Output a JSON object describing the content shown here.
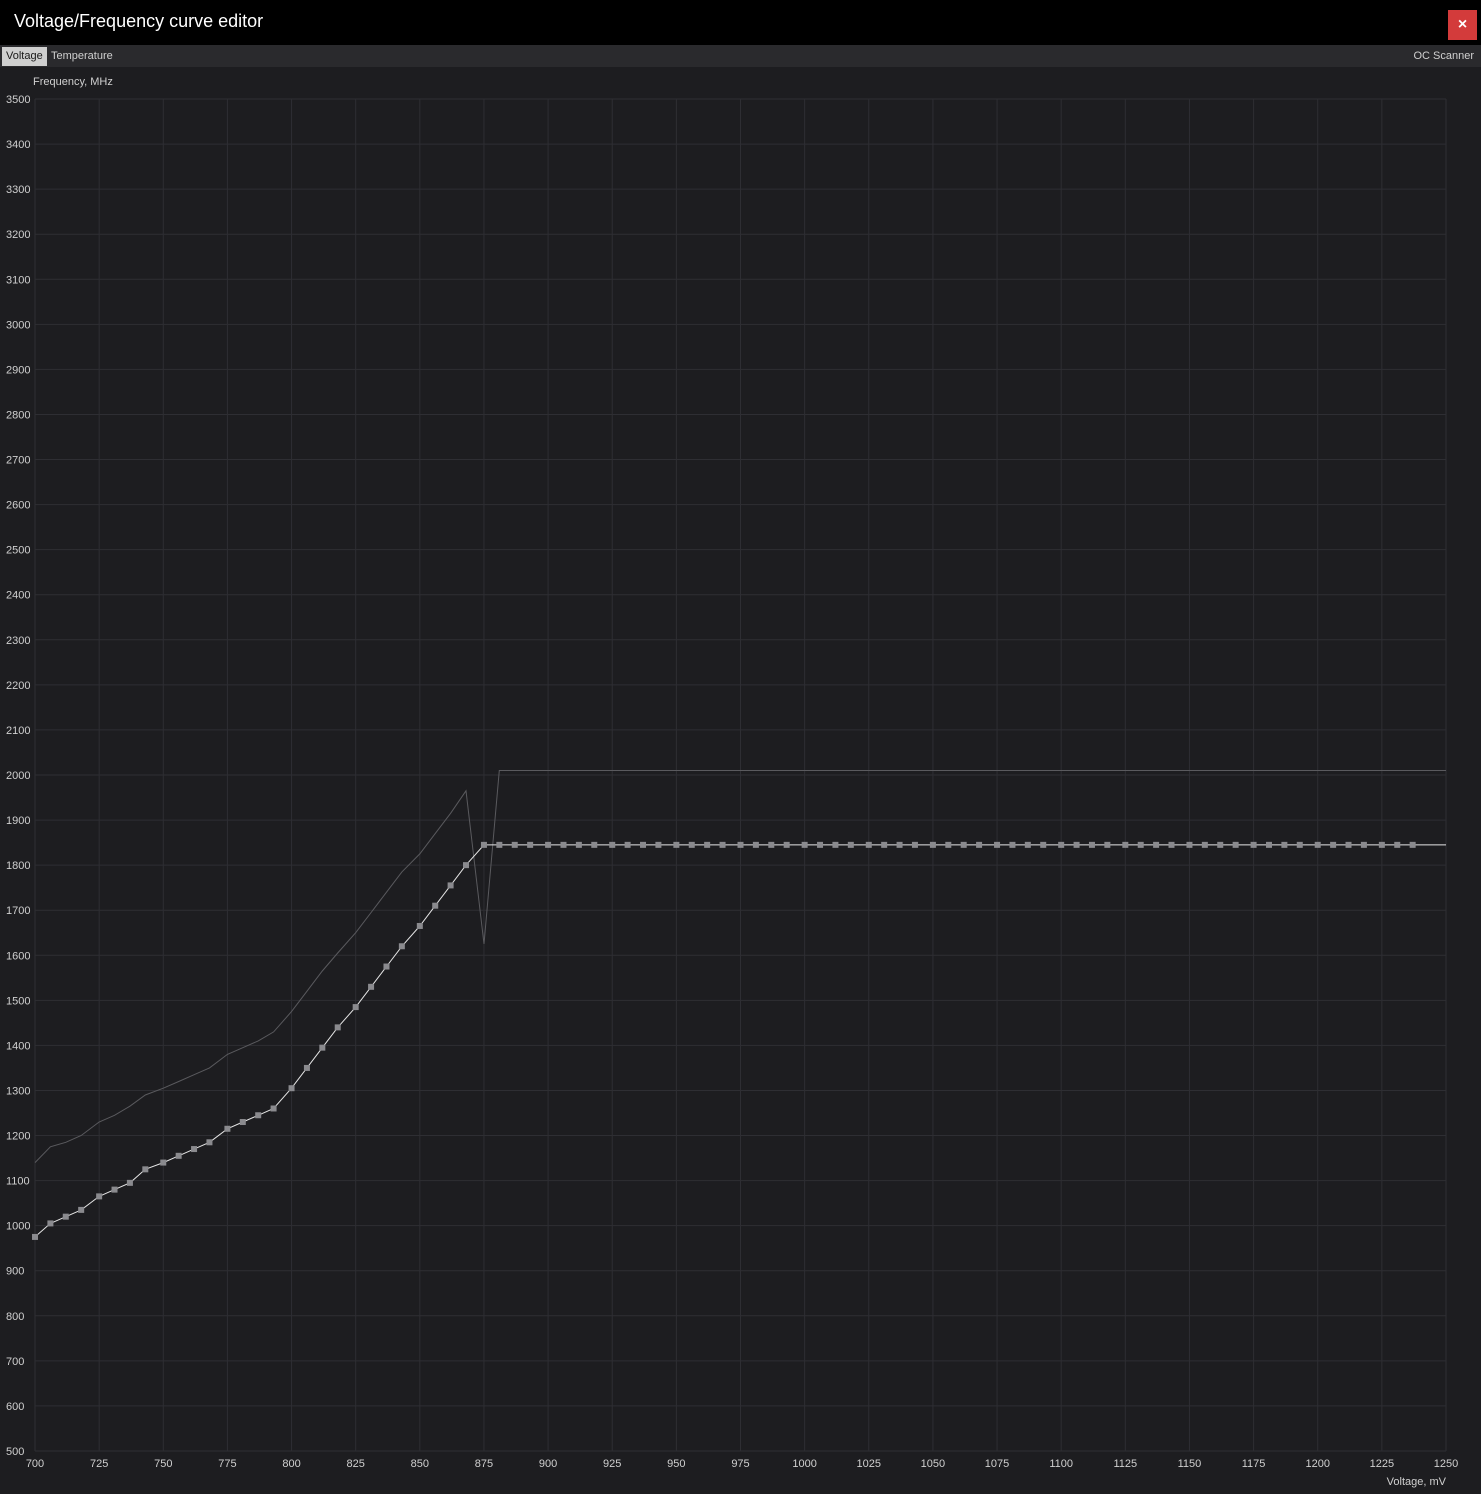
{
  "window": {
    "title": "Voltage/Frequency curve editor",
    "close_label": "×",
    "close_color": "#d33b3b"
  },
  "tabs": [
    {
      "label": "Voltage",
      "selected": true
    },
    {
      "label": "Temperature",
      "selected": false
    }
  ],
  "oc_scanner_label": "OC Scanner",
  "chart_data": {
    "type": "line",
    "xlabel": "Voltage, mV",
    "ylabel": "Frequency, MHz",
    "xlim": [
      700,
      1250
    ],
    "ylim": [
      500,
      3500
    ],
    "x_ticks": [
      700,
      725,
      750,
      775,
      800,
      825,
      850,
      875,
      900,
      925,
      950,
      975,
      1000,
      1025,
      1050,
      1075,
      1100,
      1125,
      1150,
      1175,
      1200,
      1225,
      1250
    ],
    "y_ticks": [
      500,
      600,
      700,
      800,
      900,
      1000,
      1100,
      1200,
      1300,
      1400,
      1500,
      1600,
      1700,
      1800,
      1900,
      2000,
      2100,
      2200,
      2300,
      2400,
      2500,
      2600,
      2700,
      2800,
      2900,
      3000,
      3100,
      3200,
      3300,
      3400,
      3500
    ],
    "grid": true,
    "series": [
      {
        "style": "upper-curve",
        "color": "#5a5a5e",
        "points": [
          [
            700,
            1140
          ],
          [
            706,
            1175
          ],
          [
            712,
            1185
          ],
          [
            718,
            1200
          ],
          [
            725,
            1230
          ],
          [
            731,
            1245
          ],
          [
            737,
            1265
          ],
          [
            743,
            1290
          ],
          [
            750,
            1305
          ],
          [
            756,
            1320
          ],
          [
            762,
            1335
          ],
          [
            768,
            1350
          ],
          [
            775,
            1380
          ],
          [
            781,
            1395
          ],
          [
            787,
            1410
          ],
          [
            793,
            1430
          ],
          [
            800,
            1475
          ],
          [
            806,
            1520
          ],
          [
            812,
            1565
          ],
          [
            818,
            1605
          ],
          [
            825,
            1650
          ],
          [
            831,
            1695
          ],
          [
            837,
            1740
          ],
          [
            843,
            1785
          ],
          [
            850,
            1825
          ],
          [
            856,
            1870
          ],
          [
            862,
            1915
          ],
          [
            868,
            1965
          ],
          [
            875,
            1625
          ],
          [
            881,
            2010
          ],
          [
            1250,
            2010
          ]
        ]
      },
      {
        "style": "curve-with-points",
        "color": "#e6e6e6",
        "point_color": "#8a8a8e",
        "points": [
          [
            700,
            975
          ],
          [
            706,
            1005
          ],
          [
            712,
            1020
          ],
          [
            718,
            1035
          ],
          [
            725,
            1065
          ],
          [
            731,
            1080
          ],
          [
            737,
            1095
          ],
          [
            743,
            1125
          ],
          [
            750,
            1140
          ],
          [
            756,
            1155
          ],
          [
            762,
            1170
          ],
          [
            768,
            1185
          ],
          [
            775,
            1215
          ],
          [
            781,
            1230
          ],
          [
            787,
            1245
          ],
          [
            793,
            1260
          ],
          [
            800,
            1305
          ],
          [
            806,
            1350
          ],
          [
            812,
            1395
          ],
          [
            818,
            1440
          ],
          [
            825,
            1485
          ],
          [
            831,
            1530
          ],
          [
            837,
            1575
          ],
          [
            843,
            1620
          ],
          [
            850,
            1665
          ],
          [
            856,
            1710
          ],
          [
            862,
            1755
          ],
          [
            868,
            1800
          ],
          [
            875,
            1845
          ],
          [
            881,
            1845
          ],
          [
            887,
            1845
          ],
          [
            893,
            1845
          ],
          [
            900,
            1845
          ],
          [
            906,
            1845
          ],
          [
            912,
            1845
          ],
          [
            918,
            1845
          ],
          [
            925,
            1845
          ],
          [
            931,
            1845
          ],
          [
            937,
            1845
          ],
          [
            943,
            1845
          ],
          [
            950,
            1845
          ],
          [
            956,
            1845
          ],
          [
            962,
            1845
          ],
          [
            968,
            1845
          ],
          [
            975,
            1845
          ],
          [
            981,
            1845
          ],
          [
            987,
            1845
          ],
          [
            993,
            1845
          ],
          [
            1000,
            1845
          ],
          [
            1006,
            1845
          ],
          [
            1012,
            1845
          ],
          [
            1018,
            1845
          ],
          [
            1025,
            1845
          ],
          [
            1031,
            1845
          ],
          [
            1037,
            1845
          ],
          [
            1043,
            1845
          ],
          [
            1050,
            1845
          ],
          [
            1056,
            1845
          ],
          [
            1062,
            1845
          ],
          [
            1068,
            1845
          ],
          [
            1075,
            1845
          ],
          [
            1081,
            1845
          ],
          [
            1087,
            1845
          ],
          [
            1093,
            1845
          ],
          [
            1100,
            1845
          ],
          [
            1106,
            1845
          ],
          [
            1112,
            1845
          ],
          [
            1118,
            1845
          ],
          [
            1125,
            1845
          ],
          [
            1131,
            1845
          ],
          [
            1137,
            1845
          ],
          [
            1143,
            1845
          ],
          [
            1150,
            1845
          ],
          [
            1156,
            1845
          ],
          [
            1162,
            1845
          ],
          [
            1168,
            1845
          ],
          [
            1175,
            1845
          ],
          [
            1181,
            1845
          ],
          [
            1187,
            1845
          ],
          [
            1193,
            1845
          ],
          [
            1200,
            1845
          ],
          [
            1206,
            1845
          ],
          [
            1212,
            1845
          ],
          [
            1218,
            1845
          ],
          [
            1225,
            1845
          ],
          [
            1231,
            1845
          ],
          [
            1237,
            1845
          ],
          [
            1250,
            1845
          ]
        ]
      }
    ],
    "grid_color": "#2e2e33",
    "axis_text_color": "#d0d0d0"
  }
}
